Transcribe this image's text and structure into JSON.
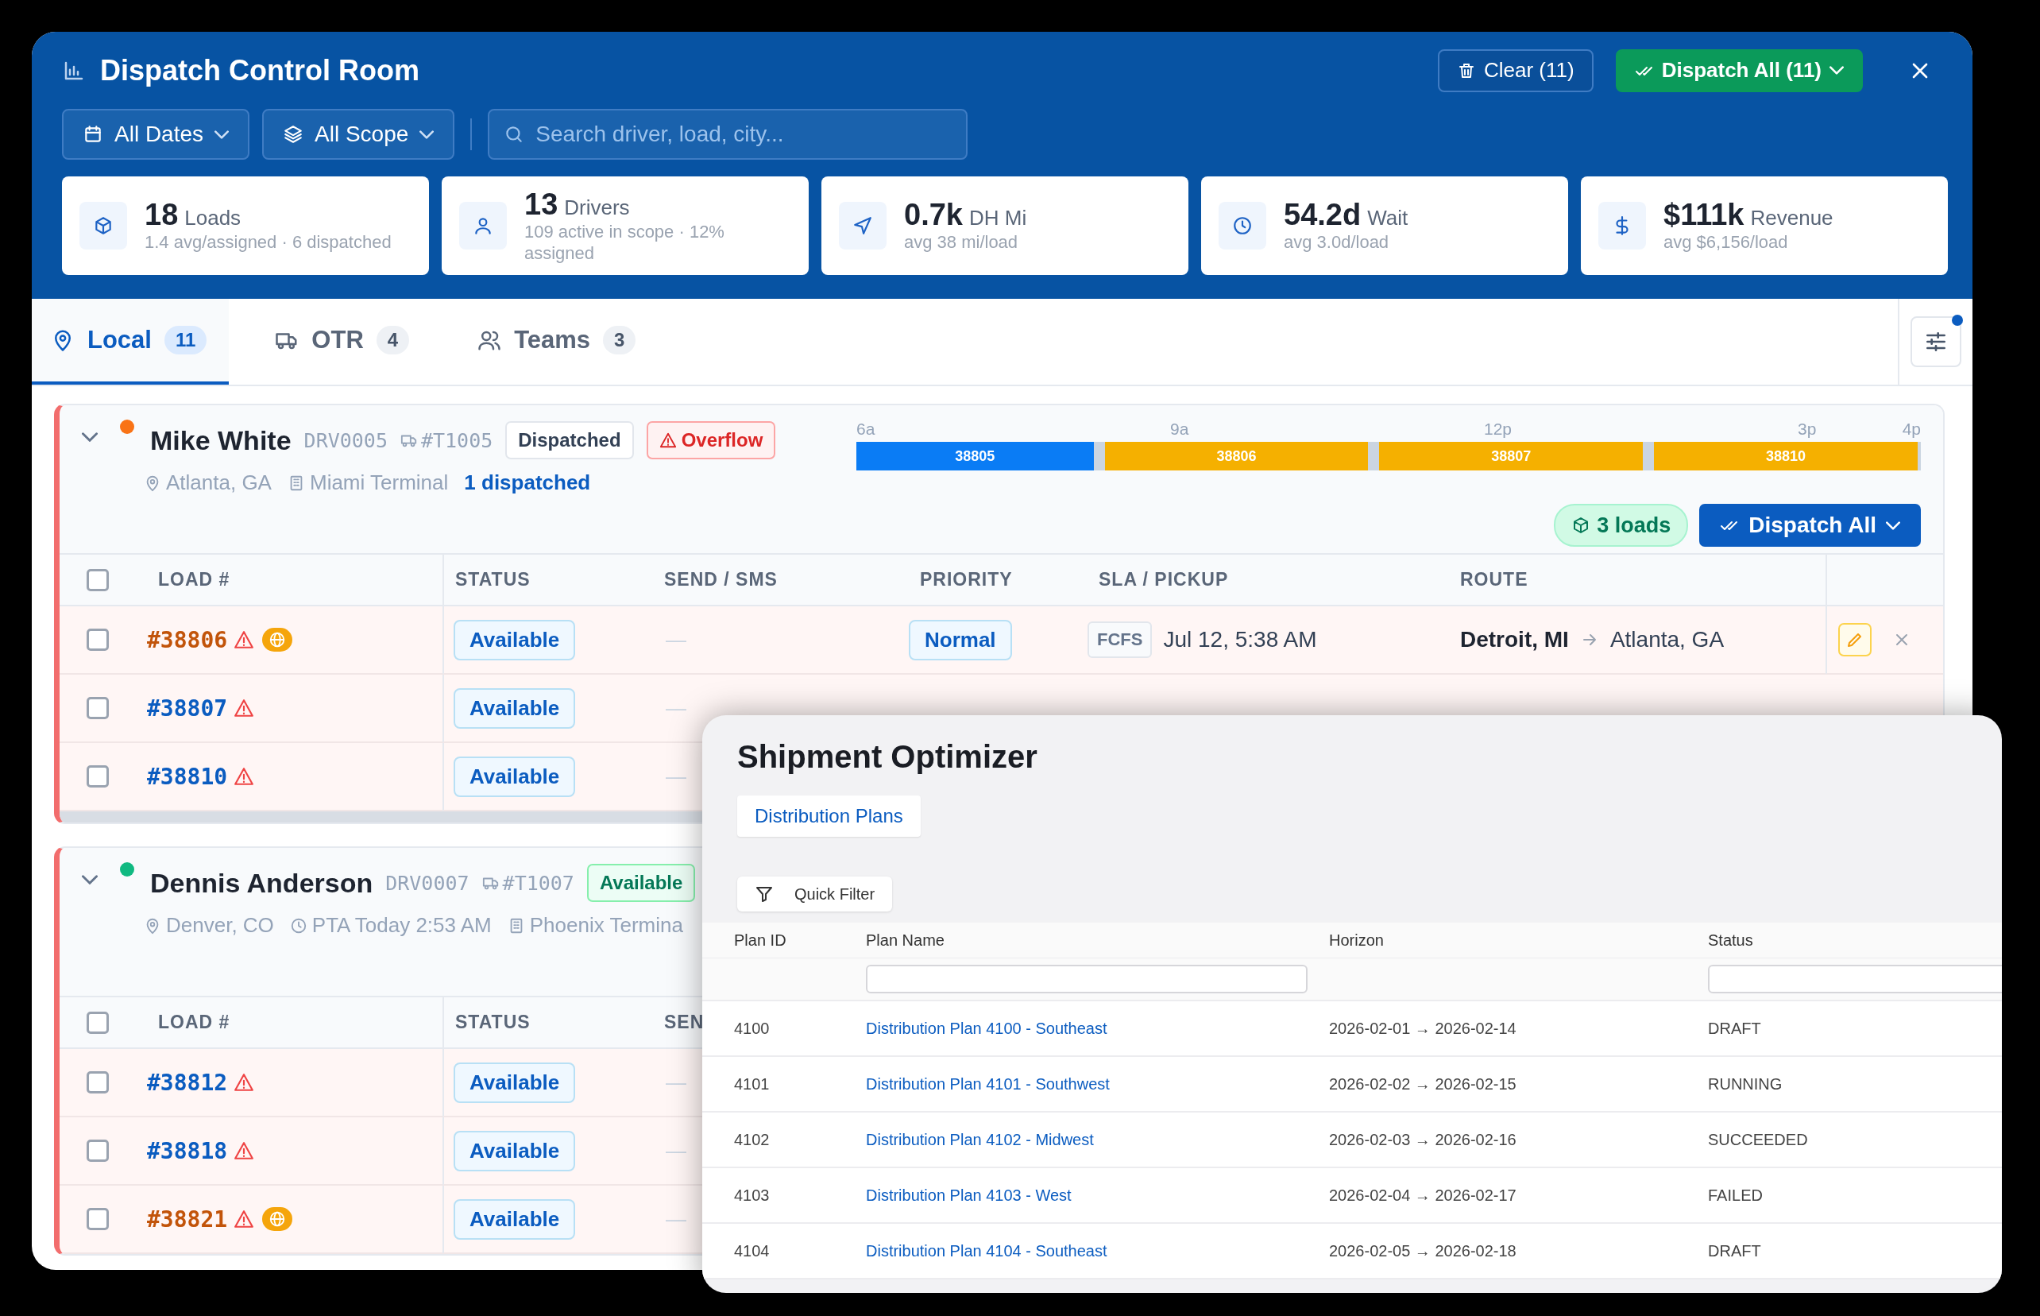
{
  "window": {
    "title": "Dispatch Control Room"
  },
  "header_actions": [
    {
      "label": "Clear (11)",
      "kind": "outline"
    },
    {
      "label": "Dispatch All (11)",
      "kind": "primary"
    }
  ],
  "filters": [
    {
      "label": "All Dates"
    },
    {
      "label": "All Scope"
    }
  ],
  "search": {
    "placeholder": "Search driver, load, city..."
  },
  "stats": [
    {
      "value": "18",
      "label": "Loads",
      "sub": "1.4 avg/assigned · 6 dispatched"
    },
    {
      "value": "13",
      "label": "Drivers",
      "sub": "109 active in scope · 12% assigned"
    },
    {
      "value": "0.7k",
      "label": "DH Mi",
      "sub": "avg 38 mi/load"
    },
    {
      "value": "54.2d",
      "label": "Wait",
      "sub": "avg 3.0d/load"
    },
    {
      "value": "$111k",
      "label": "Revenue",
      "sub": "avg $6,156/load"
    }
  ],
  "tabs": [
    {
      "label": "Local",
      "count": "11",
      "selected": true
    },
    {
      "label": "OTR",
      "count": "4",
      "selected": false
    },
    {
      "label": "Teams",
      "count": "3",
      "selected": false
    }
  ],
  "filter_settings": {
    "active": true
  },
  "drivers": [
    {
      "name": "Mike White",
      "code": "DRV0005",
      "truck": "#T1005",
      "color": "#f97316",
      "expanded": true,
      "all_checked": false,
      "badges": [
        {
          "label": "Dispatched",
          "kind": "neutral"
        },
        {
          "label": "Overflow",
          "kind": "danger"
        }
      ],
      "meta": [
        {
          "text": "Atlanta, GA",
          "kind": "location"
        },
        {
          "text": "Miami Terminal",
          "kind": "terminal"
        },
        {
          "text": "1 dispatched",
          "kind": "link"
        }
      ],
      "timeline": {
        "ticks": [
          "6a",
          "9a",
          "12p",
          "3p",
          "4p"
        ],
        "segments": [
          {
            "label": "38805",
            "kind": "dispatched"
          },
          {
            "label": "38806",
            "kind": "pending"
          },
          {
            "label": "38807",
            "kind": "pending"
          },
          {
            "label": "38810",
            "kind": "pending"
          }
        ]
      },
      "loads_badge": "3 loads",
      "dispatch_button": "Dispatch All",
      "columns": [
        "LOAD #",
        "STATUS",
        "SEND / SMS",
        "PRIORITY",
        "SLA / PICKUP",
        "ROUTE"
      ],
      "rows": [
        {
          "load": "#38806",
          "checked": false,
          "warning": true,
          "flagged": true,
          "status": "Available",
          "send": "—",
          "priority": "Normal",
          "sla": "FCFS",
          "pickup": "Jul 12, 5:38 AM",
          "origin": "Detroit, MI",
          "destination": "Atlanta, GA"
        },
        {
          "load": "#38807",
          "checked": false,
          "warning": true,
          "flagged": false,
          "status": "Available",
          "send": "—"
        },
        {
          "load": "#38810",
          "checked": false,
          "warning": true,
          "flagged": false,
          "status": "Available",
          "send": "—"
        }
      ]
    },
    {
      "name": "Dennis Anderson",
      "code": "DRV0007",
      "truck": "#T1007",
      "color": "#10b981",
      "expanded": true,
      "all_checked": false,
      "badges": [
        {
          "label": "Available",
          "kind": "success"
        }
      ],
      "meta": [
        {
          "text": "Denver, CO",
          "kind": "location"
        },
        {
          "text": "PTA Today 2:53 AM",
          "kind": "clock"
        },
        {
          "text": "Phoenix Termina",
          "kind": "terminal"
        }
      ],
      "columns": [
        "LOAD #",
        "STATUS",
        "SEN"
      ],
      "rows": [
        {
          "load": "#38812",
          "checked": false,
          "warning": true,
          "flagged": false,
          "status": "Available",
          "send": "—"
        },
        {
          "load": "#38818",
          "checked": false,
          "warning": true,
          "flagged": false,
          "status": "Available",
          "send": "—"
        },
        {
          "load": "#38821",
          "checked": false,
          "warning": true,
          "flagged": true,
          "status": "Available",
          "send": "—"
        }
      ]
    }
  ],
  "optimizer": {
    "title": "Shipment Optimizer",
    "tabs": [
      {
        "label": "Distribution Plans",
        "selected": true
      }
    ],
    "quick_filter": "Quick Filter",
    "columns": [
      {
        "label": "Plan ID",
        "filterable": false
      },
      {
        "label": "Plan Name",
        "filterable": true
      },
      {
        "label": "Horizon",
        "filterable": false
      },
      {
        "label": "Status",
        "filterable": true
      }
    ],
    "rows": [
      {
        "id": "4100",
        "name": "Distribution Plan 4100 - Southeast",
        "horizon": "2026-02-01 → 2026-02-14",
        "status": "DRAFT"
      },
      {
        "id": "4101",
        "name": "Distribution Plan 4101 - Southwest",
        "horizon": "2026-02-02 → 2026-02-15",
        "status": "RUNNING"
      },
      {
        "id": "4102",
        "name": "Distribution Plan 4102 - Midwest",
        "horizon": "2026-02-03 → 2026-02-16",
        "status": "SUCCEEDED"
      },
      {
        "id": "4103",
        "name": "Distribution Plan 4103 - West",
        "horizon": "2026-02-04 → 2026-02-17",
        "status": "FAILED"
      },
      {
        "id": "4104",
        "name": "Distribution Plan 4104 - Southeast",
        "horizon": "2026-02-05 → 2026-02-18",
        "status": "DRAFT"
      }
    ]
  }
}
